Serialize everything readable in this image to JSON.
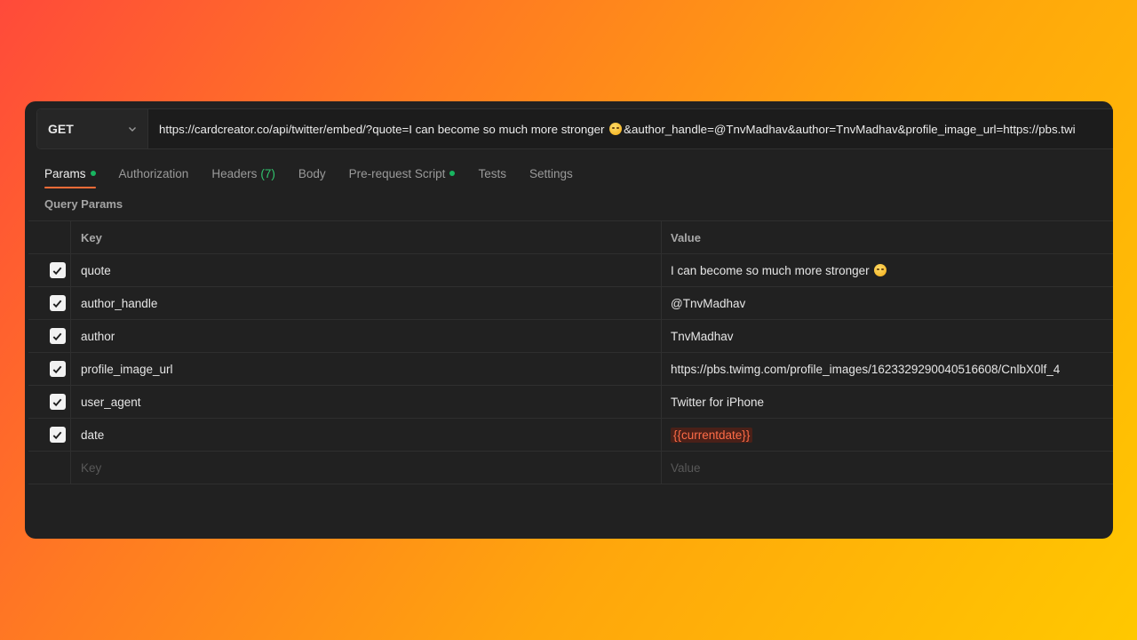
{
  "request": {
    "method": "GET",
    "url_prefix": "https://cardcreator.co/api/twitter/embed/?quote=I can become so much more stronger ",
    "url_suffix": "&author_handle=@TnvMadhav&author=TnvMadhav&profile_image_url=https://pbs.twi"
  },
  "tabs": [
    {
      "label": "Params",
      "active": true,
      "dot": true
    },
    {
      "label": "Authorization"
    },
    {
      "label": "Headers",
      "count": "(7)"
    },
    {
      "label": "Body"
    },
    {
      "label": "Pre-request Script",
      "dot": true
    },
    {
      "label": "Tests"
    },
    {
      "label": "Settings"
    }
  ],
  "query_params": {
    "title": "Query Params",
    "headers": {
      "key": "Key",
      "value": "Value"
    },
    "rows": [
      {
        "key": "quote",
        "value": "I can become so much more stronger ",
        "checked": true
      },
      {
        "key": "author_handle",
        "value": "@TnvMadhav",
        "checked": true
      },
      {
        "key": "author",
        "value": "TnvMadhav",
        "checked": true
      },
      {
        "key": "profile_image_url",
        "value": "https://pbs.twimg.com/profile_images/1623329290040516608/CnlbX0lf_4",
        "checked": true
      },
      {
        "key": "user_agent",
        "value": "Twitter for iPhone",
        "checked": true
      },
      {
        "key": "date",
        "value": "{{currentdate}}",
        "checked": true
      }
    ],
    "placeholders": {
      "key": "Key",
      "value": "Value"
    }
  },
  "icons": {
    "emoji": "grinning-face-emoji-icon",
    "dropdown": "chevron-down-icon",
    "check": "checkmark-icon"
  },
  "colors": {
    "accent": "#ff6c37",
    "status_dot": "#18b560",
    "variable": "#ff6c47"
  }
}
